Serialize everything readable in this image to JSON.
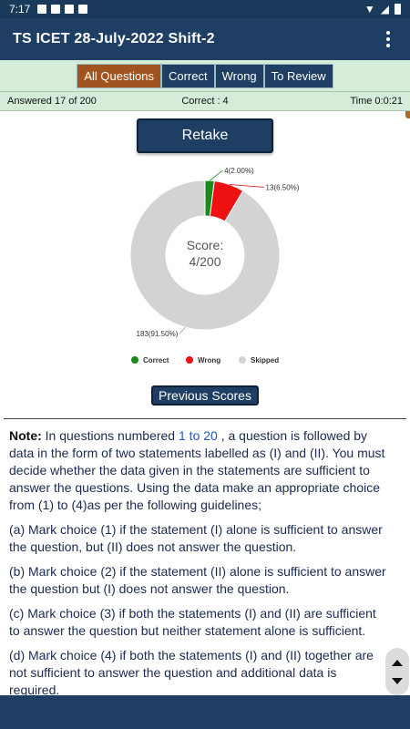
{
  "status_bar": {
    "time": "7:17"
  },
  "app_bar": {
    "title": "TS ICET 28-July-2022 Shift-2"
  },
  "tabs": [
    {
      "label": "All Questions",
      "active": true
    },
    {
      "label": "Correct",
      "active": false
    },
    {
      "label": "Wrong",
      "active": false
    },
    {
      "label": "To Review",
      "active": false
    }
  ],
  "info": {
    "answered": "Answered 17 of 200",
    "correct": "Correct : 4",
    "time": "Time 0:0:21"
  },
  "retake_label": "Retake",
  "chart_data": {
    "type": "pie",
    "categories": [
      "Correct",
      "Wrong",
      "Skipped"
    ],
    "values": [
      4,
      13,
      183
    ],
    "data_labels": [
      "4(2.00%)",
      "13(6.50%)",
      "183(91.50%)"
    ],
    "colors": [
      "#1a8a1a",
      "#ee1111",
      "#d3d3d3"
    ],
    "center_line1": "Score:",
    "center_line2": "4/200",
    "legend_position": "bottom"
  },
  "previous_scores_label": "Previous Scores",
  "note": {
    "label": "Note:",
    "intro_before": " In questions numbered ",
    "range": "1 to 20",
    "intro_after": " , a question is followed by data in the form of two statements labelled as (I) and (II). You must decide whether the data given in the statements are sufficient to answer the questions. Using the data make an appropriate choice from (1) to (4)as per the following guidelines;",
    "items": [
      "(a) Mark choice (1) if the statement (I) alone is sufficient to answer the question, but (II) does not answer the question.",
      "(b) Mark choice (2) if the statement (II) alone is sufficient to answer the question but (I) does not answer the question.",
      "(c) Mark choice (3) if both the statements (I) and (II) are sufficient to answer the question but neither statement alone is sufficient.",
      "(d) Mark choice (4) if both the statements (I) and (II) together are not sufficient to answer the question and additional data is required."
    ]
  }
}
